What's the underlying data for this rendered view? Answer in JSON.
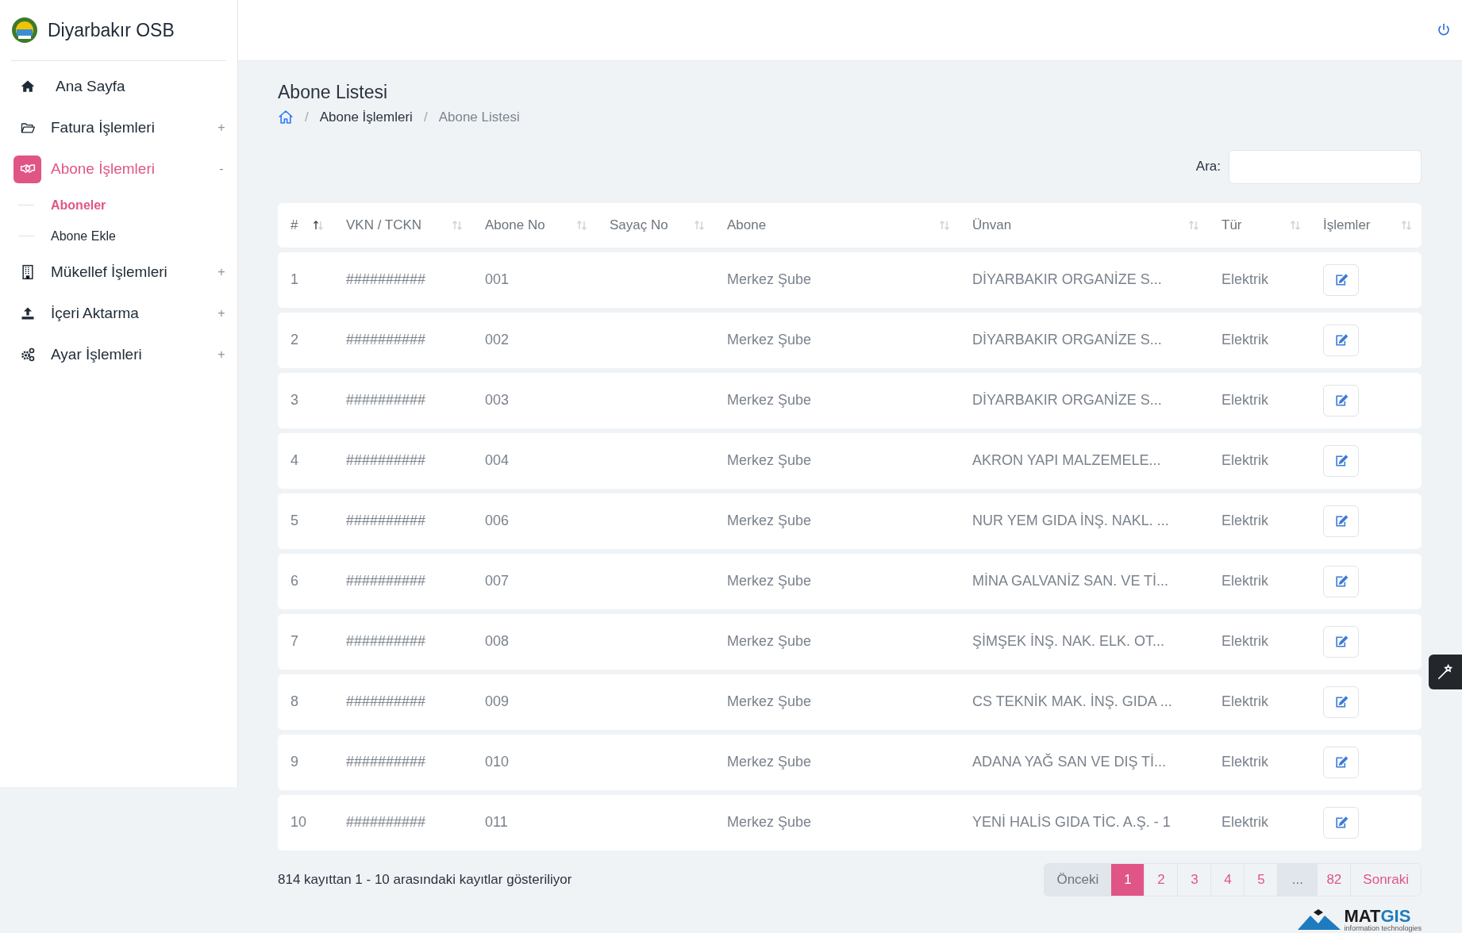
{
  "brand": {
    "name": "Diyarbakır OSB"
  },
  "sidebar": {
    "items": [
      {
        "label": "Ana Sayfa",
        "selected": false
      },
      {
        "label": "Fatura İşlemleri",
        "toggle": "+",
        "selected": false
      },
      {
        "label": "Abone İşlemleri",
        "toggle": "-",
        "selected": true,
        "children": [
          {
            "label": "Aboneler",
            "selected": true
          },
          {
            "label": "Abone Ekle",
            "selected": false
          }
        ]
      },
      {
        "label": "Mükellef İşlemleri",
        "toggle": "+",
        "selected": false
      },
      {
        "label": "İçeri Aktarma",
        "toggle": "+",
        "selected": false
      },
      {
        "label": "Ayar İşlemleri",
        "toggle": "+",
        "selected": false
      }
    ]
  },
  "page": {
    "title": "Abone Listesi",
    "breadcrumb": [
      {
        "label": "/",
        "kind": "separator"
      },
      {
        "label": "Abone İşlemleri",
        "kind": "link"
      },
      {
        "label": "/",
        "kind": "separator"
      },
      {
        "label": "Abone Listesi",
        "kind": "current"
      }
    ]
  },
  "search": {
    "label": "Ara:"
  },
  "table": {
    "columns": [
      {
        "label": "#",
        "sorted": true
      },
      {
        "label": "VKN / TCKN",
        "sorted": false
      },
      {
        "label": "Abone No",
        "sorted": false
      },
      {
        "label": "Sayaç No",
        "sorted": false
      },
      {
        "label": "Abone",
        "sorted": false
      },
      {
        "label": "Ünvan",
        "sorted": false
      },
      {
        "label": "Tür",
        "sorted": false
      },
      {
        "label": "İşlemler",
        "sorted": false
      }
    ],
    "rows": [
      [
        "1",
        "##########",
        "001",
        "",
        "Merkez Şube",
        "DİYARBAKIR ORGANİZE S...",
        "Elektrik"
      ],
      [
        "2",
        "##########",
        "002",
        "",
        "Merkez Şube",
        "DİYARBAKIR ORGANİZE S...",
        "Elektrik"
      ],
      [
        "3",
        "##########",
        "003",
        "",
        "Merkez Şube",
        "DİYARBAKIR ORGANİZE S...",
        "Elektrik"
      ],
      [
        "4",
        "##########",
        "004",
        "",
        "Merkez Şube",
        "AKRON YAPI MALZEMELE...",
        "Elektrik"
      ],
      [
        "5",
        "##########",
        "006",
        "",
        "Merkez Şube",
        "NUR YEM GIDA İNŞ. NAKL. ...",
        "Elektrik"
      ],
      [
        "6",
        "##########",
        "007",
        "",
        "Merkez Şube",
        "MİNA GALVANİZ SAN. VE Tİ...",
        "Elektrik"
      ],
      [
        "7",
        "##########",
        "008",
        "",
        "Merkez Şube",
        "ŞİMŞEK İNŞ. NAK. ELK. OT...",
        "Elektrik"
      ],
      [
        "8",
        "##########",
        "009",
        "",
        "Merkez Şube",
        "CS TEKNİK MAK. İNŞ. GIDA ...",
        "Elektrik"
      ],
      [
        "9",
        "##########",
        "010",
        "",
        "Merkez Şube",
        "ADANA YAĞ SAN VE DIŞ Tİ...",
        "Elektrik"
      ],
      [
        "10",
        "##########",
        "011",
        "",
        "Merkez Şube",
        "YENİ HALİS GIDA TİC. A.Ş. - 1",
        "Elektrik"
      ]
    ]
  },
  "footer": {
    "info": "814 kayıttan 1 - 10 arasındaki kayıtlar gösteriliyor"
  },
  "pagination": [
    {
      "label": "Önceki",
      "kind": "nav",
      "selected": false,
      "disabled": true
    },
    {
      "label": "1",
      "kind": "page",
      "selected": true,
      "disabled": false
    },
    {
      "label": "2",
      "kind": "page",
      "selected": false,
      "disabled": false
    },
    {
      "label": "3",
      "kind": "page",
      "selected": false,
      "disabled": false
    },
    {
      "label": "4",
      "kind": "page",
      "selected": false,
      "disabled": false
    },
    {
      "label": "5",
      "kind": "page",
      "selected": false,
      "disabled": false
    },
    {
      "label": "...",
      "kind": "gap",
      "selected": false,
      "disabled": true
    },
    {
      "label": "82",
      "kind": "page",
      "selected": false,
      "disabled": false
    },
    {
      "label": "Sonraki",
      "kind": "nav",
      "selected": false,
      "disabled": false
    }
  ],
  "vendor": {
    "name_dark": "MAT",
    "name_accent": "GIS",
    "tagline": "information technologies"
  }
}
